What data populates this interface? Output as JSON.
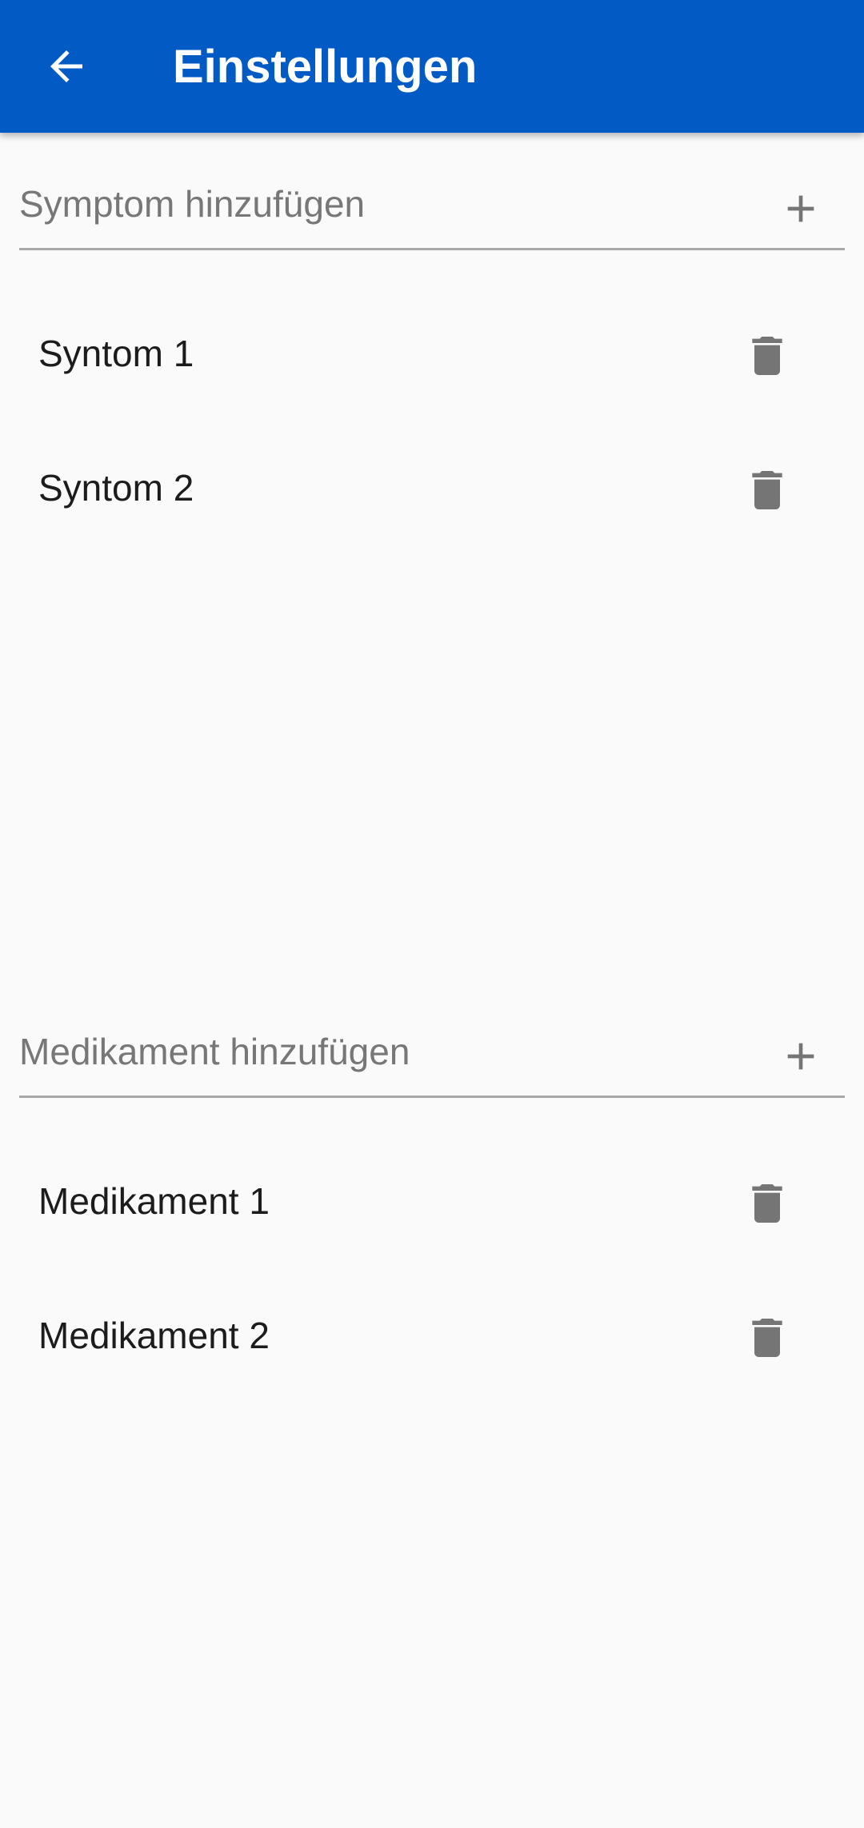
{
  "appbar": {
    "title": "Einstellungen",
    "back_icon": "arrow-back-icon",
    "background": "#025bc4"
  },
  "symptoms": {
    "input_placeholder": "Symptom hinzufügen",
    "input_value": "",
    "add_icon": "plus-icon",
    "items": [
      {
        "label": "Syntom 1",
        "delete_icon": "trash-icon"
      },
      {
        "label": "Syntom 2",
        "delete_icon": "trash-icon"
      }
    ]
  },
  "medications": {
    "input_placeholder": "Medikament hinzufügen",
    "input_value": "",
    "add_icon": "plus-icon",
    "items": [
      {
        "label": "Medikament 1",
        "delete_icon": "trash-icon"
      },
      {
        "label": "Medikament 2",
        "delete_icon": "trash-icon"
      }
    ]
  },
  "colors": {
    "primary": "#025bc4",
    "background": "#fafafa",
    "icon_gray": "#757575",
    "divider": "#a8a8a8"
  }
}
